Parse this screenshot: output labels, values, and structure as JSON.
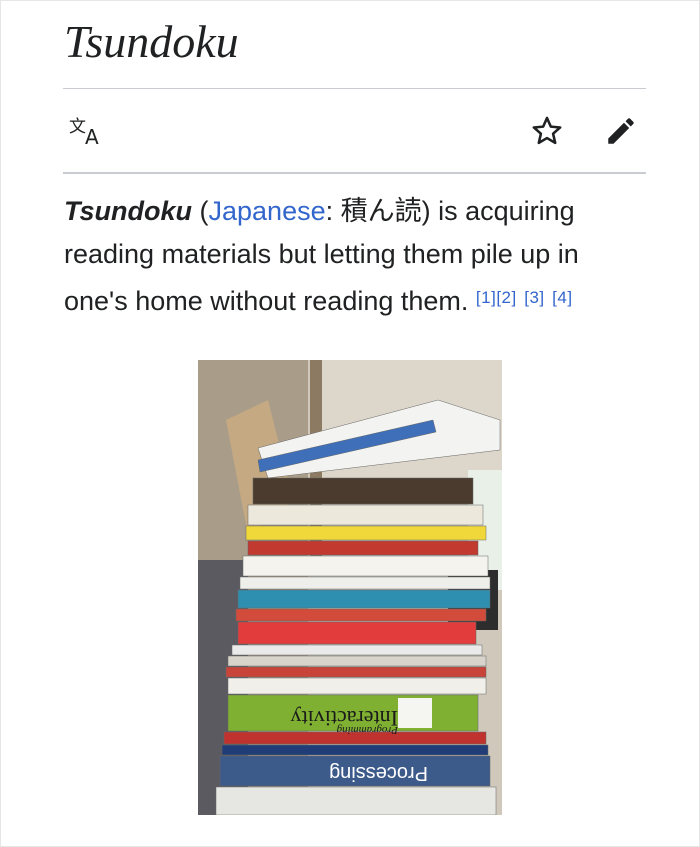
{
  "article": {
    "title": "Tsundoku",
    "lead": {
      "term": "Tsundoku",
      "open_paren": " (",
      "language_link": "Japanese",
      "native_text": ": 積ん読",
      "close_paren": ")",
      "definition": " is acquiring reading materials but letting them pile up in one's home without reading them. ",
      "references": [
        "[1]",
        "[2]",
        "[3]",
        "[4]"
      ]
    }
  },
  "toolbar": {
    "icons": [
      "language-icon",
      "star-icon",
      "edit-icon"
    ]
  },
  "image": {
    "book_spines": [
      "Interactivity",
      "Processing",
      "Programming"
    ]
  },
  "colors": {
    "link": "#3366cc",
    "text": "#202122",
    "divider": "#c8ccd1"
  }
}
